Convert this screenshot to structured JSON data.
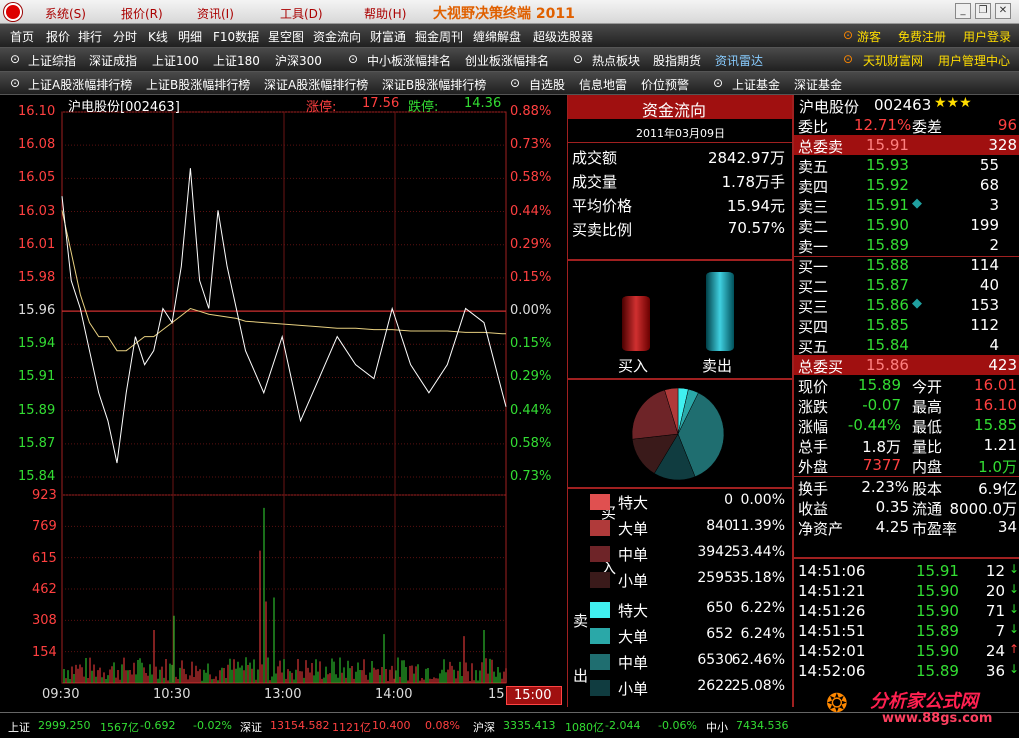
{
  "menu": [
    {
      "label": "系统(S)",
      "key": "system"
    },
    {
      "label": "报价(R)",
      "key": "quote"
    },
    {
      "label": "资讯(I)",
      "key": "news"
    },
    {
      "label": "工具(D)",
      "key": "tools"
    },
    {
      "label": "帮助(H)",
      "key": "help"
    }
  ],
  "app_title": "大视野决策终端 2011",
  "toolbar1": [
    "首页",
    "报价",
    "排行",
    "分时",
    "K线",
    "明细",
    "F10数据",
    "星空图",
    "资金流向",
    "财富通",
    "掘金周刊",
    "缠绵解盘",
    "超级选股器"
  ],
  "toolbar1_right": [
    "游客",
    "免费注册",
    "用户登录"
  ],
  "toolbar2": [
    "上证综指",
    "深证成指",
    "上证100",
    "上证180",
    "沪深300",
    "中小板涨幅排名",
    "创业板涨幅排名",
    "热点板块",
    "股指期货",
    "资讯雷达"
  ],
  "toolbar2_right": [
    "天玑财富网",
    "用户管理中心"
  ],
  "toolbar3": [
    "上证A股涨幅排行榜",
    "上证B股涨幅排行榜",
    "深证A股涨幅排行榜",
    "深证B股涨幅排行榜",
    "自选股",
    "信息地雷",
    "价位预警",
    "上证基金",
    "深证基金"
  ],
  "chart": {
    "stock_title": "沪电股份[002463]",
    "limit_up_label": "涨停:",
    "limit_up": "17.56",
    "limit_down_label": "跌停:",
    "limit_down": "14.36",
    "price_ticks": [
      "16.10",
      "16.08",
      "16.05",
      "16.03",
      "16.01",
      "15.98",
      "15.96",
      "15.94",
      "15.91",
      "15.89",
      "15.87",
      "15.84"
    ],
    "pct_ticks": [
      "0.88%",
      "0.73%",
      "0.58%",
      "0.44%",
      "0.29%",
      "0.15%",
      "0.00%",
      "0.15%",
      "0.29%",
      "0.44%",
      "0.58%",
      "0.73%"
    ],
    "volume_ticks": [
      "923",
      "769",
      "615",
      "462",
      "308",
      "154"
    ],
    "time_ticks": [
      "09:30",
      "10:30",
      "13:00",
      "14:00",
      "15"
    ],
    "current_time": "15:00"
  },
  "chart_data": {
    "type": "line",
    "title": "沪电股份[002463]",
    "x": [
      0,
      5,
      10,
      15,
      20,
      25,
      30,
      35,
      40,
      45,
      50,
      55,
      60,
      65,
      70,
      75,
      80,
      85,
      90,
      95,
      100,
      110,
      120,
      130,
      140,
      150,
      160,
      170,
      180,
      190,
      200,
      210,
      220,
      230,
      240,
      242
    ],
    "series": [
      {
        "name": "price",
        "values": [
          16.04,
          15.98,
          15.96,
          15.93,
          15.9,
          15.88,
          15.85,
          15.9,
          15.94,
          15.92,
          15.93,
          15.96,
          15.95,
          15.99,
          16.06,
          15.98,
          15.96,
          16.03,
          15.99,
          15.96,
          15.93,
          15.9,
          15.94,
          15.88,
          15.91,
          15.94,
          15.92,
          15.91,
          15.96,
          15.92,
          15.9,
          15.92,
          15.96,
          15.95,
          15.9,
          15.89
        ]
      },
      {
        "name": "avg",
        "values": [
          16.03,
          16.0,
          15.97,
          15.95,
          15.94,
          15.94,
          15.93,
          15.93,
          15.935,
          15.94,
          15.94,
          15.945,
          15.95,
          15.955,
          15.96,
          15.958,
          15.956,
          15.955,
          15.954,
          15.953,
          15.951,
          15.95,
          15.949,
          15.948,
          15.947,
          15.946,
          15.946,
          15.945,
          15.945,
          15.944,
          15.944,
          15.944,
          15.943,
          15.943,
          15.942,
          15.942
        ]
      }
    ],
    "ylim": [
      15.84,
      16.1
    ],
    "volume_max": 923
  },
  "fund_flow": {
    "title": "资金流向",
    "date": "2011年03月09日",
    "rows": [
      {
        "label": "成交额",
        "value": "2842.97万"
      },
      {
        "label": "成交量",
        "value": "1.78万手"
      },
      {
        "label": "平均价格",
        "value": "15.94元"
      },
      {
        "label": "买卖比例",
        "value": "70.57%"
      }
    ],
    "buy_label": "买入",
    "sell_label": "卖出",
    "buy_side_label": "买入",
    "sell_side_label": "卖出",
    "buy": [
      {
        "label": "特大",
        "vol": "0",
        "pct": "0.00%",
        "color": "#e05050"
      },
      {
        "label": "大单",
        "vol": "840",
        "pct": "11.39%",
        "color": "#b03a3a"
      },
      {
        "label": "中单",
        "vol": "3942",
        "pct": "53.44%",
        "color": "#6e2428"
      },
      {
        "label": "小单",
        "vol": "2595",
        "pct": "35.18%",
        "color": "#3a1a1a"
      }
    ],
    "sell": [
      {
        "label": "特大",
        "vol": "650",
        "pct": "6.22%",
        "color": "#40f0f0"
      },
      {
        "label": "大单",
        "vol": "652",
        "pct": "6.24%",
        "color": "#2aa8a8"
      },
      {
        "label": "中单",
        "vol": "6530",
        "pct": "62.46%",
        "color": "#1f6e70"
      },
      {
        "label": "小单",
        "vol": "2622",
        "pct": "25.08%",
        "color": "#103c40"
      }
    ]
  },
  "quote": {
    "name": "沪电股份",
    "code": "002463",
    "stars": "★★★",
    "webi_label": "委比",
    "webi": "12.71%",
    "weicha_label": "委差",
    "weicha": "96",
    "total_sell_label": "总委卖",
    "total_sell_price": "15.91",
    "total_sell_vol": "328",
    "asks": [
      {
        "label": "卖五",
        "price": "15.93",
        "vol": "55",
        "mark": ""
      },
      {
        "label": "卖四",
        "price": "15.92",
        "vol": "68",
        "mark": ""
      },
      {
        "label": "卖三",
        "price": "15.91",
        "vol": "3",
        "mark": "◆"
      },
      {
        "label": "卖二",
        "price": "15.90",
        "vol": "199",
        "mark": ""
      },
      {
        "label": "卖一",
        "price": "15.89",
        "vol": "2",
        "mark": ""
      }
    ],
    "bids": [
      {
        "label": "买一",
        "price": "15.88",
        "vol": "114",
        "mark": ""
      },
      {
        "label": "买二",
        "price": "15.87",
        "vol": "40",
        "mark": ""
      },
      {
        "label": "买三",
        "price": "15.86",
        "vol": "153",
        "mark": "◆"
      },
      {
        "label": "买四",
        "price": "15.85",
        "vol": "112",
        "mark": ""
      },
      {
        "label": "买五",
        "price": "15.84",
        "vol": "4",
        "mark": ""
      }
    ],
    "total_buy_label": "总委买",
    "total_buy_price": "15.86",
    "total_buy_vol": "423",
    "stats": [
      {
        "l1": "现价",
        "v1": "15.89",
        "c1": "#33dd33",
        "l2": "今开",
        "v2": "16.01",
        "c2": "#ff4040"
      },
      {
        "l1": "涨跌",
        "v1": "-0.07",
        "c1": "#33dd33",
        "l2": "最高",
        "v2": "16.10",
        "c2": "#ff4040"
      },
      {
        "l1": "涨幅",
        "v1": "-0.44%",
        "c1": "#33dd33",
        "l2": "最低",
        "v2": "15.85",
        "c2": "#33dd33"
      },
      {
        "l1": "总手",
        "v1": "1.8万",
        "c1": "#ffffff",
        "l2": "量比",
        "v2": "1.21",
        "c2": "#ffffff"
      },
      {
        "l1": "外盘",
        "v1": "7377",
        "c1": "#ff4040",
        "l2": "内盘",
        "v2": "1.0万",
        "c2": "#33dd33"
      }
    ],
    "fundamentals": [
      {
        "l1": "换手",
        "v1": "2.23%",
        "l2": "股本",
        "v2": "6.9亿"
      },
      {
        "l1": "收益",
        "v1": "0.35",
        "l2": "流通",
        "v2": "8000.0万"
      },
      {
        "l1": "净资产",
        "v1": "4.25",
        "l2": "市盈率",
        "v2": "34"
      }
    ],
    "ticks": [
      {
        "time": "14:51:06",
        "price": "15.91",
        "vol": "12",
        "dir": "down"
      },
      {
        "time": "14:51:21",
        "price": "15.90",
        "vol": "20",
        "dir": "down"
      },
      {
        "time": "14:51:26",
        "price": "15.90",
        "vol": "71",
        "dir": "down"
      },
      {
        "time": "14:51:51",
        "price": "15.89",
        "vol": "7",
        "dir": "down"
      },
      {
        "time": "14:52:01",
        "price": "15.90",
        "vol": "24",
        "dir": "up"
      },
      {
        "time": "14:52:06",
        "price": "15.89",
        "vol": "36",
        "dir": "down"
      }
    ]
  },
  "status": {
    "items": [
      {
        "name": "上证",
        "value": "2999.250",
        "amount": "1567亿",
        "change": "-0.692",
        "pct": "-0.02%",
        "color": "#33dd33"
      },
      {
        "name": "深证",
        "value": "13154.582",
        "amount": "1121亿",
        "change": "10.400",
        "pct": "0.08%",
        "color": "#ff4040"
      },
      {
        "name": "沪深",
        "value": "3335.413",
        "amount": "1080亿",
        "change": "-2.044",
        "pct": "-0.06%",
        "color": "#33dd33"
      },
      {
        "name": "中小",
        "value": "7434.536",
        "amount": "",
        "change": "",
        "pct": "",
        "color": "#33dd33"
      }
    ],
    "watermark": "分析家公式网",
    "watermark_url": "www.88gs.com"
  }
}
